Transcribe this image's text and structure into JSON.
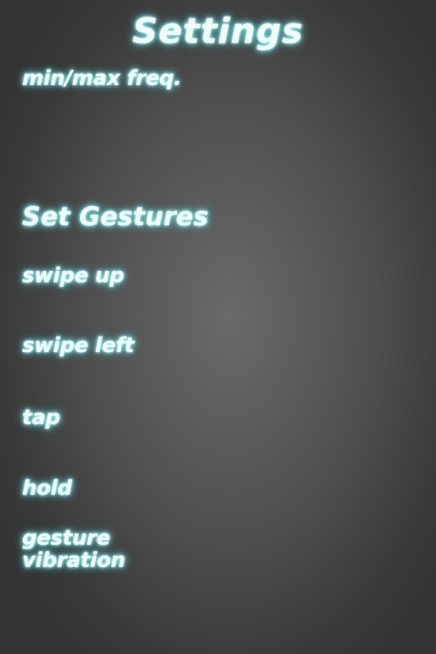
{
  "header": {
    "title": "Settings"
  },
  "settings": {
    "freq_label": "min/max freq."
  },
  "gestures": {
    "section_title": "Set Gestures",
    "items": [
      {
        "label": "swipe up"
      },
      {
        "label": "swipe left"
      },
      {
        "label": "tap"
      },
      {
        "label": "hold"
      }
    ],
    "vibration_line1": "gesture",
    "vibration_line2": "vibration"
  },
  "colors": {
    "text": "#f2fbfb",
    "glow": "#7fe3ea",
    "background_center": "#6a6a6a",
    "background_edge": "#343434"
  }
}
